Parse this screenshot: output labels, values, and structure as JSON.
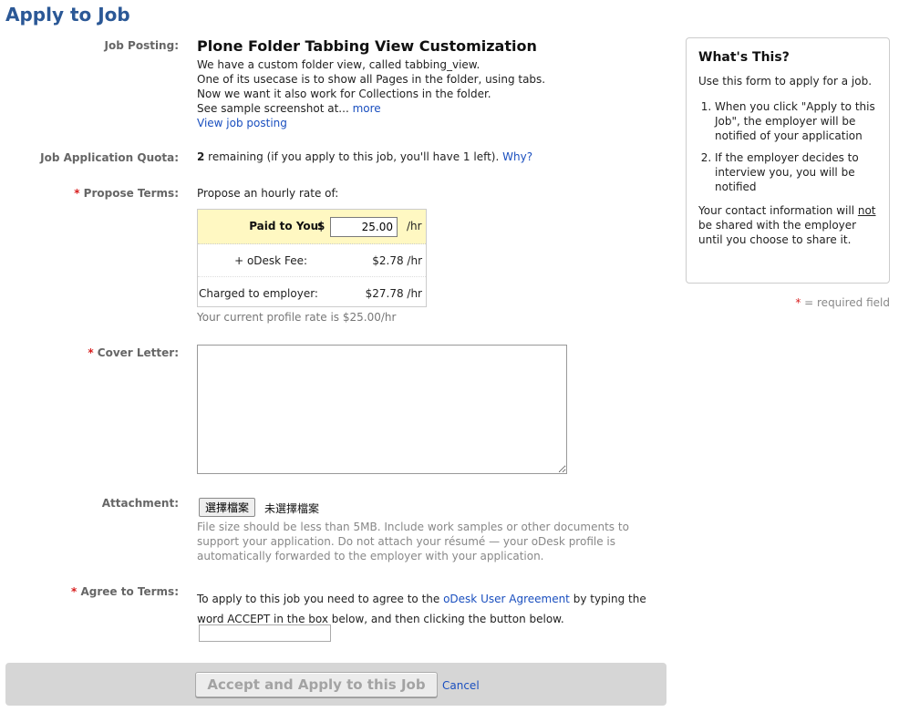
{
  "page": {
    "title": "Apply to Job"
  },
  "job_posting": {
    "label": "Job Posting:",
    "title": "Plone Folder Tabbing View Customization",
    "description_lines": [
      "We have a custom folder view, called tabbing_view.",
      "One of its usecase is to show all Pages in the folder, using tabs.",
      "Now we want it also work for Collections in the folder.",
      "See sample screenshot at..."
    ],
    "more_link": "more",
    "view_link": "View job posting"
  },
  "quota": {
    "label": "Job Application Quota:",
    "count": "2",
    "text": " remaining (if you apply to this job, you'll have 1 left).",
    "why_link": "Why?"
  },
  "terms": {
    "label": "Propose Terms:",
    "intro": "Propose an hourly rate of:",
    "paid_label": "Paid to You:",
    "currency": "$",
    "rate_value": "25.00",
    "unit": "/hr",
    "fee_label": "+ oDesk Fee:",
    "fee_value": "$2.78 /hr",
    "charged_label": "Charged to employer:",
    "charged_value": "$27.78 /hr",
    "profile_rate": "Your current profile rate is $25.00/hr"
  },
  "cover_letter": {
    "label": "Cover Letter:",
    "value": ""
  },
  "attachment": {
    "label": "Attachment:",
    "button": "選擇檔案",
    "status": "未選擇檔案",
    "help": "File size should be less than 5MB. Include work samples or other documents to support your application. Do not attach your résumé — your oDesk profile is automatically forwarded to the employer with your application."
  },
  "agree": {
    "label": "Agree to Terms:",
    "text_before": "To apply to this job you need to agree to the ",
    "link": "oDesk User Agreement",
    "text_after": " by typing the word ACCEPT in the box below, and then clicking the button below.",
    "input_value": ""
  },
  "actions": {
    "submit": "Accept and Apply to this Job",
    "cancel": "Cancel"
  },
  "sidebar": {
    "title": "What's This?",
    "intro": "Use this form to apply for a job.",
    "steps": [
      "When you click \"Apply to this Job\", the employer will be notified of your application",
      "If the employer decides to interview you, you will be notified"
    ],
    "contact_before": "Your contact information will ",
    "contact_emph": "not",
    "contact_after": " be shared with the employer until you choose to share it."
  },
  "required_note": {
    "star": "*",
    "text": " = required field"
  },
  "colors": {
    "title": "#2b5896",
    "required": "#d81e1e",
    "highlight": "#fff8c2",
    "link": "#1a4fbf"
  }
}
